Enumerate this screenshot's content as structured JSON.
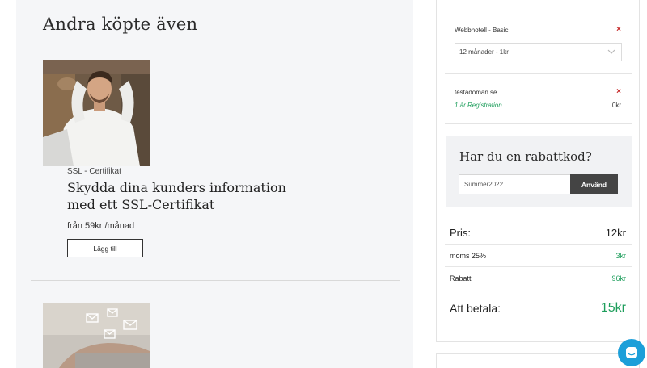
{
  "upsell": {
    "heading": "Andra köpte även",
    "products": [
      {
        "category": "SSL - Certifikat",
        "title": "Skydda dina kunders information med ett SSL-Certifikat",
        "price": "från 59kr /månad",
        "button_label": "Lägg till"
      }
    ]
  },
  "cart": {
    "items": [
      {
        "name": "Webbhotell - Basic",
        "remove_icon": "×",
        "period_select": "12 månader - 1kr"
      },
      {
        "name": "testadomän.se",
        "remove_icon": "×",
        "registration": "1 år Registration",
        "price": "0kr"
      }
    ],
    "coupon": {
      "title": "Har du en rabattkod?",
      "input_value": "Summer2022",
      "button_label": "Använd"
    },
    "summary": {
      "price_label": "Pris:",
      "price_value": "12kr",
      "vat_label": "moms 25%",
      "vat_value": "3kr",
      "discount_label": "Rabatt",
      "discount_value": "96kr",
      "total_label": "Att betala:",
      "total_value": "15kr"
    }
  },
  "colors": {
    "accent_green": "#1e9e5c",
    "remove_red": "#c62828",
    "chat_blue": "#1c9fd9",
    "button_dark": "#444444"
  },
  "icons": {
    "select": "chevron-down-icon",
    "remove": "close-icon",
    "chat": "chat-icon"
  }
}
